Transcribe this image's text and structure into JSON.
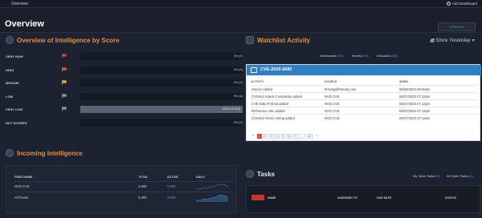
{
  "topbar": {
    "tab": "Overview",
    "add_dashboard": "Add Dashboard"
  },
  "page": {
    "title": "Overview",
    "lock_label": "Unlocked"
  },
  "score_section": {
    "title": "Overview of Intelligence by Score",
    "rows": [
      {
        "label": "VERY HIGH",
        "flag_color": "#e0403a",
        "percent": 0,
        "display": "0% (0)"
      },
      {
        "label": "HIGH",
        "flag_color": "#f05a28",
        "percent": 0,
        "display": "0% (0)"
      },
      {
        "label": "MEDIUM",
        "flag_color": "#f2a33a",
        "percent": 0,
        "display": "0% (0)"
      },
      {
        "label": "LOW",
        "flag_color": "#8a93a3",
        "percent": 0,
        "display": "0% (0)"
      },
      {
        "label": "VERY LOW",
        "flag_color": "#8a93a3",
        "percent": 100,
        "display": "100% (3,959)"
      },
      {
        "label": "NOT SCORED",
        "flag_color": "",
        "percent": 0,
        "display": "0% (0)"
      }
    ]
  },
  "incoming": {
    "title": "Incoming Intelligence",
    "headers": {
      "feed": "FEED NAME",
      "total": "TOTAL",
      "active": "ACTIVE",
      "daily": "DAILY"
    },
    "rows": [
      {
        "feed": "NVD CVE",
        "total": "3,959",
        "active": "3,959"
      },
      {
        "feed": "All Feeds",
        "total": "3,959",
        "active": "3,959"
      }
    ]
  },
  "watchlist": {
    "title": "Watchlist Activity",
    "since": "Since Yesterday",
    "tabs": [
      {
        "label": "Adversaries",
        "count": "(0/0)"
      },
      {
        "label": "Events",
        "count": "(0/0)"
      },
      {
        "label": "Indicators",
        "count": "(0/0)"
      }
    ],
    "card_title": "CVE-2016-5681",
    "headers": {
      "activity": "ACTIVITY",
      "source": "SOURCE",
      "when": "WHEN"
    },
    "rows": [
      {
        "activity": "Source added",
        "source": "threatq@threatq.com",
        "when": "06/28/2023 06:40pm"
      },
      {
        "activity": "CVSSv3 Attack Complexity added",
        "source": "NVD CVE",
        "when": "06/27/2023 07:12pm"
      },
      {
        "activity": "CVE Data Format added",
        "source": "NVD CVE",
        "when": "06/27/2023 07:12pm"
      },
      {
        "activity": "Reference URL added",
        "source": "NVD CVE",
        "when": "06/27/2023 07:12pm"
      },
      {
        "activity": "CVSSv2 Vector String added",
        "source": "NVD CVE",
        "when": "06/27/2023 07:12pm"
      }
    ],
    "pagination": [
      "«",
      "1",
      "2",
      "3",
      "4",
      "5",
      "6",
      "7",
      "...",
      "12",
      "»"
    ]
  },
  "tasks": {
    "title": "Tasks",
    "filters": {
      "mine": "My Open Tasks",
      "mine_count": "(0)",
      "all": "All Open Tasks",
      "all_count": "(0)"
    },
    "headers": {
      "name": "NAME",
      "assigned": "ASSIGNED TO",
      "due": "DUE DATE",
      "status": "STATUS"
    }
  }
}
